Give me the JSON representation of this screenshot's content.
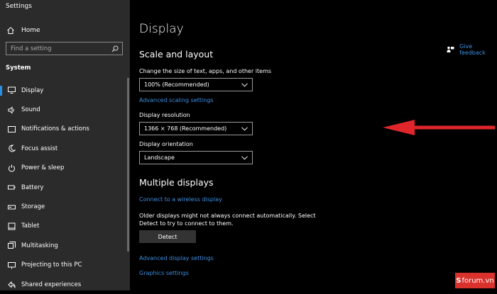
{
  "window": {
    "title": "Settings"
  },
  "sidebar": {
    "home_label": "Home",
    "search_placeholder": "Find a setting",
    "section_label": "System",
    "items": [
      {
        "label": "Display",
        "icon": "monitor-icon",
        "active": true
      },
      {
        "label": "Sound",
        "icon": "speaker-icon"
      },
      {
        "label": "Notifications & actions",
        "icon": "notification-icon"
      },
      {
        "label": "Focus assist",
        "icon": "moon-icon"
      },
      {
        "label": "Power & sleep",
        "icon": "power-icon"
      },
      {
        "label": "Battery",
        "icon": "battery-icon"
      },
      {
        "label": "Storage",
        "icon": "storage-icon"
      },
      {
        "label": "Tablet",
        "icon": "tablet-icon"
      },
      {
        "label": "Multitasking",
        "icon": "multitasking-icon"
      },
      {
        "label": "Projecting to this PC",
        "icon": "projector-icon"
      },
      {
        "label": "Shared experiences",
        "icon": "shared-icon"
      }
    ]
  },
  "main": {
    "title": "Display",
    "scale_layout": {
      "heading": "Scale and layout",
      "size_label": "Change the size of text, apps, and other items",
      "size_value": "100% (Recommended)",
      "advanced_scaling_link": "Advanced scaling settings",
      "resolution_label": "Display resolution",
      "resolution_value": "1366 × 768 (Recommended)",
      "orientation_label": "Display orientation",
      "orientation_value": "Landscape"
    },
    "multiple_displays": {
      "heading": "Multiple displays",
      "wireless_link": "Connect to a wireless display",
      "note": "Older displays might not always connect automatically. Select Detect to try to connect to them.",
      "detect_button": "Detect",
      "advanced_display_link": "Advanced display settings",
      "graphics_link": "Graphics settings"
    },
    "feedback_link": "Give feedback"
  },
  "watermark": {
    "s": "S",
    "text": "forum.vn"
  },
  "colors": {
    "accent": "#3b8fe2",
    "sidebar_bg": "#2b2b2b",
    "annotation_arrow": "#e0262b"
  }
}
